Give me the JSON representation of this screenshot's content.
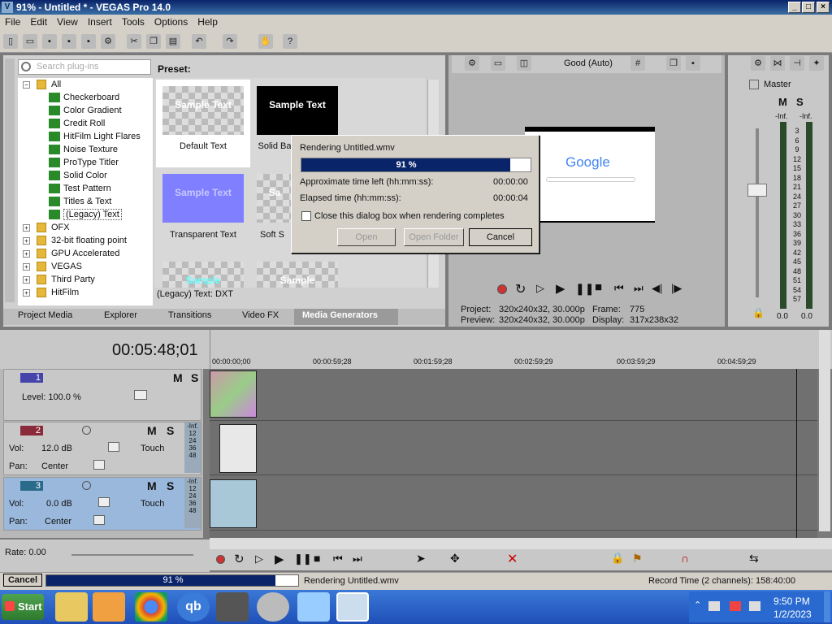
{
  "window": {
    "title": "91% - Untitled * - VEGAS Pro 14.0",
    "min": "_",
    "max": "□",
    "close": "×",
    "app_icon": "V"
  },
  "menu": [
    "File",
    "Edit",
    "View",
    "Insert",
    "Tools",
    "Options",
    "Help"
  ],
  "plugins": {
    "search_placeholder": "Search plug-ins",
    "tree": [
      {
        "label": "All",
        "kind": "folder"
      },
      {
        "label": "Checkerboard",
        "kind": "fx"
      },
      {
        "label": "Color Gradient",
        "kind": "fx"
      },
      {
        "label": "Credit Roll",
        "kind": "fx"
      },
      {
        "label": "HitFilm Light Flares",
        "kind": "fx"
      },
      {
        "label": "Noise Texture",
        "kind": "fx"
      },
      {
        "label": "ProType Titler",
        "kind": "fx"
      },
      {
        "label": "Solid Color",
        "kind": "fx"
      },
      {
        "label": "Test Pattern",
        "kind": "fx"
      },
      {
        "label": "Titles & Text",
        "kind": "fx"
      },
      {
        "label": "(Legacy) Text",
        "kind": "fx"
      },
      {
        "label": "OFX",
        "kind": "group"
      },
      {
        "label": "32-bit floating point",
        "kind": "group"
      },
      {
        "label": "GPU Accelerated",
        "kind": "group"
      },
      {
        "label": "VEGAS",
        "kind": "group"
      },
      {
        "label": "Third Party",
        "kind": "group"
      },
      {
        "label": "HitFilm",
        "kind": "group"
      }
    ],
    "preset_label": "Preset:",
    "presets": [
      {
        "thumb": "Sample Text",
        "label": "Default Text"
      },
      {
        "thumb": "Sample Text",
        "label": "Solid Ba"
      },
      {
        "thumb": "Sample Text",
        "label": "Transparent Text"
      },
      {
        "thumb": "Sa",
        "label": "Soft S"
      },
      {
        "thumb": "Sample",
        "label": ""
      },
      {
        "thumb": "Sample",
        "label": ""
      }
    ],
    "footer": "(Legacy) Text: DXT",
    "tabs": [
      "Project Media",
      "Explorer",
      "Transitions",
      "Video FX",
      "Media Generators"
    ]
  },
  "preview": {
    "quality": "Good (Auto)",
    "google_logo": "Google",
    "project_label": "Project:",
    "project_value": "320x240x32, 30.000p",
    "preview_label": "Preview:",
    "preview_value": "320x240x32, 30.000p",
    "frame_label": "Frame:",
    "frame_value": "775",
    "display_label": "Display:",
    "display_value": "317x238x32"
  },
  "master": {
    "label": "Master",
    "m": "M",
    "s": "S",
    "inf_left": "-Inf.",
    "inf_right": "-Inf.",
    "scale": [
      "3",
      "6",
      "9",
      "12",
      "15",
      "18",
      "21",
      "24",
      "27",
      "30",
      "33",
      "36",
      "39",
      "42",
      "45",
      "48",
      "51",
      "54",
      "57"
    ],
    "bottom_left": "0.0",
    "bottom_right": "0.0"
  },
  "timeline": {
    "timecode": "00:05:48;01",
    "ruler": [
      "00:00:00;00",
      "00:00:59;28",
      "00:01:59;28",
      "00:02:59;29",
      "00:03:59;29",
      "00:04:59;29"
    ],
    "tracks": [
      {
        "num": "1",
        "level_label": "Level: 100.0 %",
        "m": "M",
        "s": "S"
      },
      {
        "num": "2",
        "vol_label": "Vol:",
        "vol": "12.0 dB",
        "pan_label": "Pan:",
        "pan": "Center",
        "mode": "Touch",
        "m": "M",
        "s": "S",
        "meter": [
          "-Inf.",
          "12",
          "24",
          "36",
          "48"
        ]
      },
      {
        "num": "3",
        "vol_label": "Vol:",
        "vol": "0.0 dB",
        "pan_label": "Pan:",
        "pan": "Center",
        "mode": "Touch",
        "m": "M",
        "s": "S",
        "meter": [
          "-Inf.",
          "12",
          "24",
          "36",
          "48"
        ]
      }
    ],
    "rate": "Rate: 0.00"
  },
  "render_dialog": {
    "title": "Rendering Untitled.wmv",
    "progress": 91,
    "progress_text": "91 %",
    "time_left_label": "Approximate time left (hh:mm:ss):",
    "time_left": "00:00:00",
    "elapsed_label": "Elapsed time (hh:mm:ss):",
    "elapsed": "00:00:04",
    "close_checkbox": "Close this dialog box when rendering completes",
    "open_btn": "Open",
    "open_folder_btn": "Open Folder",
    "cancel_btn": "Cancel"
  },
  "status": {
    "cancel": "Cancel",
    "progress": 91,
    "progress_text": "91 %",
    "message": "Rendering Untitled.wmv",
    "record_time": "Record Time (2 channels): 158:40:00"
  },
  "taskbar": {
    "start": "Start",
    "time": "9:50 PM",
    "date": "1/2/2023"
  }
}
